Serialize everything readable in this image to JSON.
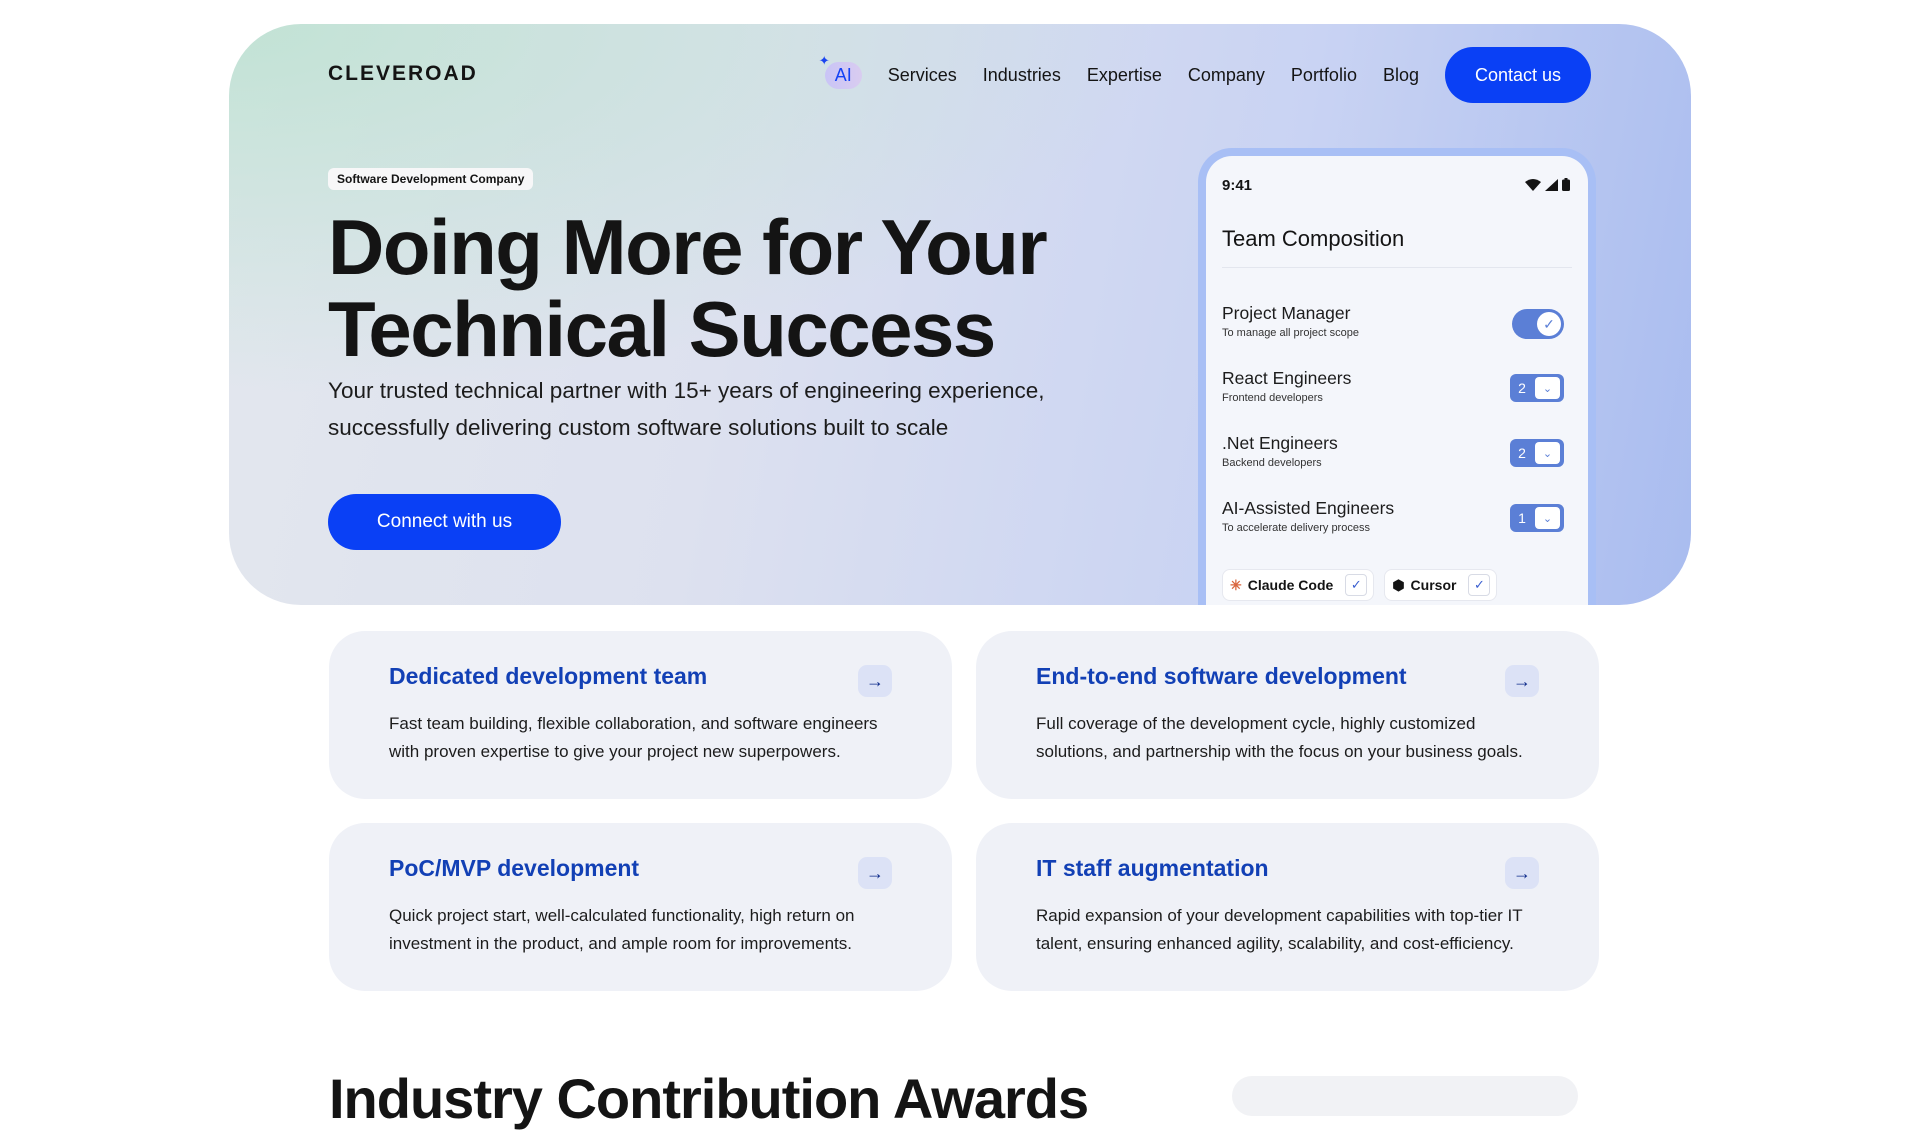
{
  "header": {
    "logo": "CLEVEROAD",
    "nav": {
      "ai_label": "AI",
      "items": [
        "Services",
        "Industries",
        "Expertise",
        "Company",
        "Portfolio",
        "Blog"
      ],
      "contact_label": "Contact us"
    }
  },
  "hero": {
    "badge": "Software Development Company",
    "headline_line1": "Doing More for Your",
    "headline_line2": "Technical Success",
    "subheadline": "Your trusted technical partner with 15+ years of engineering experience, successfully delivering custom software solutions built to scale",
    "cta_label": "Connect with us"
  },
  "team_panel": {
    "time": "9:41",
    "title": "Team Composition",
    "rows": [
      {
        "title": "Project Manager",
        "subtitle": "To manage all project scope",
        "control": "toggle",
        "checked": true
      },
      {
        "title": "React Engineers",
        "subtitle": "Frontend developers",
        "control": "stepper",
        "count": "2"
      },
      {
        "title": ".Net Engineers",
        "subtitle": "Backend developers",
        "control": "stepper",
        "count": "2"
      },
      {
        "title": "AI-Assisted Engineers",
        "subtitle": "To accelerate delivery process",
        "control": "stepper",
        "count": "1"
      }
    ],
    "tools": [
      {
        "name": "Claude Code",
        "icon": "claude-icon",
        "checked": true
      },
      {
        "name": "Cursor",
        "icon": "cursor-icon",
        "checked": true
      }
    ]
  },
  "services": [
    {
      "title": "Dedicated development team",
      "description": "Fast team building, flexible collaboration, and software engineers with proven expertise to give your project new superpowers."
    },
    {
      "title": "End-to-end software development",
      "description": "Full coverage of the development cycle, highly customized solutions, and partnership with the focus on your business goals."
    },
    {
      "title": "PoC/MVP development",
      "description": "Quick project start, well-calculated functionality, high return on investment in the product, and ample room for improvements."
    },
    {
      "title": "IT staff augmentation",
      "description": "Rapid expansion of your development capabilities with top-tier IT talent, ensuring enhanced agility, scalability, and cost-efficiency."
    }
  ],
  "next_section": {
    "heading_partial": "Industry Contribution Awards"
  },
  "colors": {
    "accent": "#0a40f5",
    "card_title": "#1240b5",
    "card_bg": "#eff1f7",
    "panel_control": "#5b7fd6"
  }
}
